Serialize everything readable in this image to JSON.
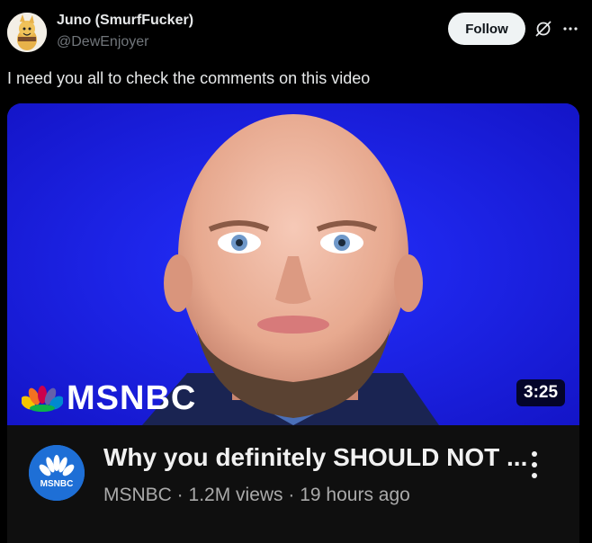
{
  "author": {
    "display_name": "Juno (SmurfFucker)",
    "handle": "@DewEnjoyer",
    "avatar_icon": "cartoon-avatar-icon"
  },
  "actions": {
    "follow_label": "Follow",
    "grok_icon": "grok-icon",
    "more_icon": "more-icon"
  },
  "tweet": {
    "text": "I need you all to check the comments on this video"
  },
  "video": {
    "thumbnail_logo_text": "MSNBC",
    "duration": "3:25",
    "title": "Why you definitely SHOULD NOT ...",
    "channel": "MSNBC",
    "views": "1.2M views",
    "age": "19 hours ago",
    "channel_avatar_text": "MSNBC",
    "meta_separator": " · "
  },
  "colors": {
    "background": "#000000",
    "thumbnail_bg": "#1a1ee0",
    "card_bg": "#0f0f0f",
    "follow_bg": "#eff3f4",
    "channel_avatar_bg": "#1e6fd6"
  }
}
